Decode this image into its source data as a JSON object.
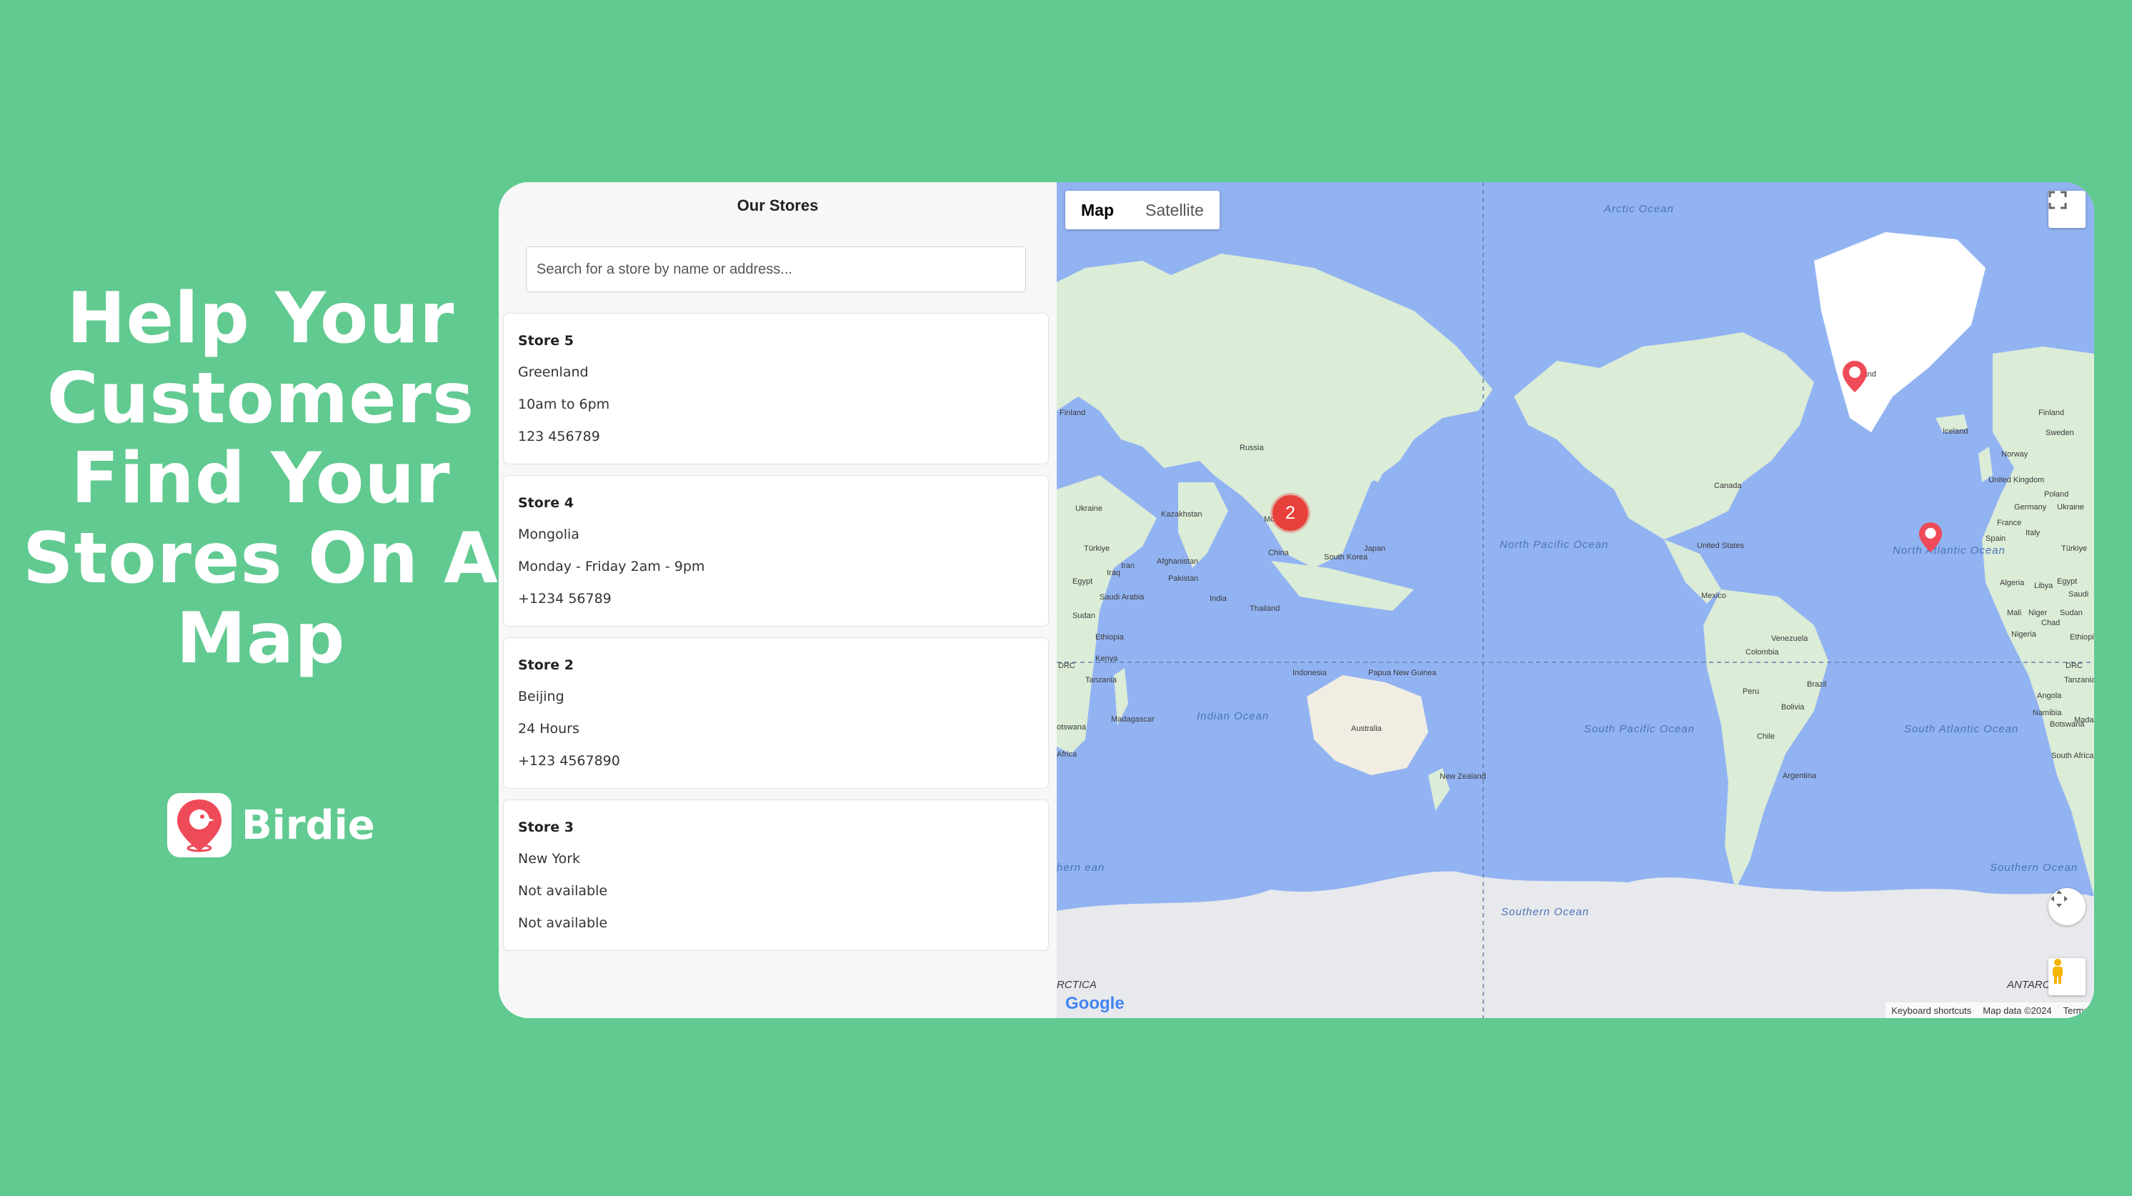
{
  "promo": {
    "title": "Help Your Customers Find Your Stores On A Map",
    "brand_name": "Birdie"
  },
  "sidebar": {
    "title": "Our Stores",
    "search_placeholder": "Search for a store by name or address...",
    "stores": [
      {
        "name": "Store 5",
        "location": "Greenland",
        "hours": "10am to 6pm",
        "phone": "123 456789"
      },
      {
        "name": "Store 4",
        "location": "Mongolia",
        "hours": "Monday - Friday 2am - 9pm",
        "phone": "+1234 56789"
      },
      {
        "name": "Store 2",
        "location": "Beijing",
        "hours": "24 Hours",
        "phone": "+123 4567890"
      },
      {
        "name": "Store 3",
        "location": "New York",
        "hours": "Not available",
        "phone": "Not available"
      }
    ]
  },
  "map": {
    "tabs": {
      "map": "Map",
      "satellite": "Satellite"
    },
    "cluster_count": "2",
    "google": "Google",
    "footer": {
      "shortcuts": "Keyboard shortcuts",
      "data": "Map data ©2024",
      "terms": "Terms"
    },
    "labels": {
      "arctic": "Arctic Ocean",
      "north_pacific": "North Pacific Ocean",
      "north_atlantic": "North Atlantic Ocean",
      "indian": "Indian Ocean",
      "south_pacific": "South Pacific Ocean",
      "south_atlantic": "South Atlantic Ocean",
      "southern_left": "hern ean",
      "southern": "Southern Ocean",
      "southern_right": "Southern Ocean",
      "antarctica_left": "RCTICA",
      "antarctica_right": "ANTARCT",
      "russia": "Russia",
      "kazakhstan": "Kazakhstan",
      "mongolia": "Mon",
      "china": "China",
      "japan": "Japan",
      "south_korea": "South Korea",
      "india": "India",
      "thailand": "Thailand",
      "indonesia": "Indonesia",
      "png": "Papua New Guinea",
      "australia": "Australia",
      "new_zealand": "New Zealand",
      "afghanistan": "Afghanistan",
      "pakistan": "Pakistan",
      "iran": "Iran",
      "iraq": "Iraq",
      "turkey": "Türkiye",
      "egypt": "Egypt",
      "saudi_arabia": "Saudi Arabia",
      "sudan": "Sudan",
      "ethiopia": "Ethiopia",
      "kenya": "Kenya",
      "drc": "DRC",
      "tanzania": "Tanzania",
      "madagascar": "Madagascar",
      "botswana": "otswana",
      "south_africa": "Africa",
      "finland": "Finland",
      "ukraine": "Ukraine",
      "canada": "Canada",
      "united_states": "United States",
      "mexico": "Mexico",
      "venezuela": "Venezuela",
      "colombia": "Colombia",
      "peru": "Peru",
      "brazil": "Brazil",
      "bolivia": "Bolivia",
      "chile": "Chile",
      "argentina": "Argentina",
      "greenland": "land",
      "iceland": "Iceland",
      "finland_r": "Finland",
      "sweden": "Sweden",
      "norway": "Norway",
      "uk": "United Kingdom",
      "germany": "Germany",
      "poland": "Poland",
      "ukraine_r": "Ukraine",
      "france": "France",
      "spain": "Spain",
      "italy": "Italy",
      "turkey_r": "Türkiye",
      "algeria": "Algeria",
      "libya": "Libya",
      "egypt_r": "Egypt",
      "mali": "Mali",
      "niger": "Niger",
      "chad": "Chad",
      "sudan_r": "Sudan",
      "nigeria": "Nigeria",
      "ethiopia_r": "Ethiopia",
      "drc_r": "DRC",
      "tanzania_r": "Tanzania",
      "angola": "Angola",
      "namibia": "Namibia",
      "botswana_r": "Botswana",
      "south_africa_r": "South Africa",
      "mada_r": "Mada",
      "saudi_r": "Saudi"
    }
  }
}
